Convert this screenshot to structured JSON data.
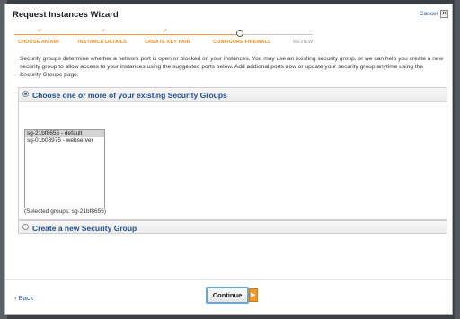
{
  "dialog": {
    "title": "Request Instances Wizard",
    "cancel_label": "Cancel",
    "close_glyph": "✕"
  },
  "steps": [
    {
      "label": "CHOOSE AN AMI",
      "state": "done"
    },
    {
      "label": "INSTANCE DETAILS",
      "state": "done"
    },
    {
      "label": "CREATE KEY PAIR",
      "state": "done"
    },
    {
      "label": "CONFIGURE FIREWALL",
      "state": "current"
    },
    {
      "label": "REVIEW",
      "state": "todo"
    }
  ],
  "check_glyph": "✓",
  "intro_text": "Security groups determine whether a network port is open or blocked on your instances. You may use an existing security group, or we can help you create a new security group to allow access to your instances using the suggested ports below. Add addional ports now or update your security group anytime using the Security Groups page.",
  "existing": {
    "heading": "Choose one or more of your existing Security Groups",
    "groups": [
      "sg-21bf8655 - default",
      "sg-01b08975 - webserver"
    ],
    "selected_text": "(Selected groups: sg-21bf8655)"
  },
  "new_group": {
    "heading": "Create a new Security Group"
  },
  "footer": {
    "back_label": "‹ Back",
    "continue_label": "Continue",
    "continue_arrow": "▶"
  },
  "colors": {
    "accent_orange": "#e8922d",
    "link_blue": "#2b5797",
    "heading_blue": "#1f4f8e"
  }
}
